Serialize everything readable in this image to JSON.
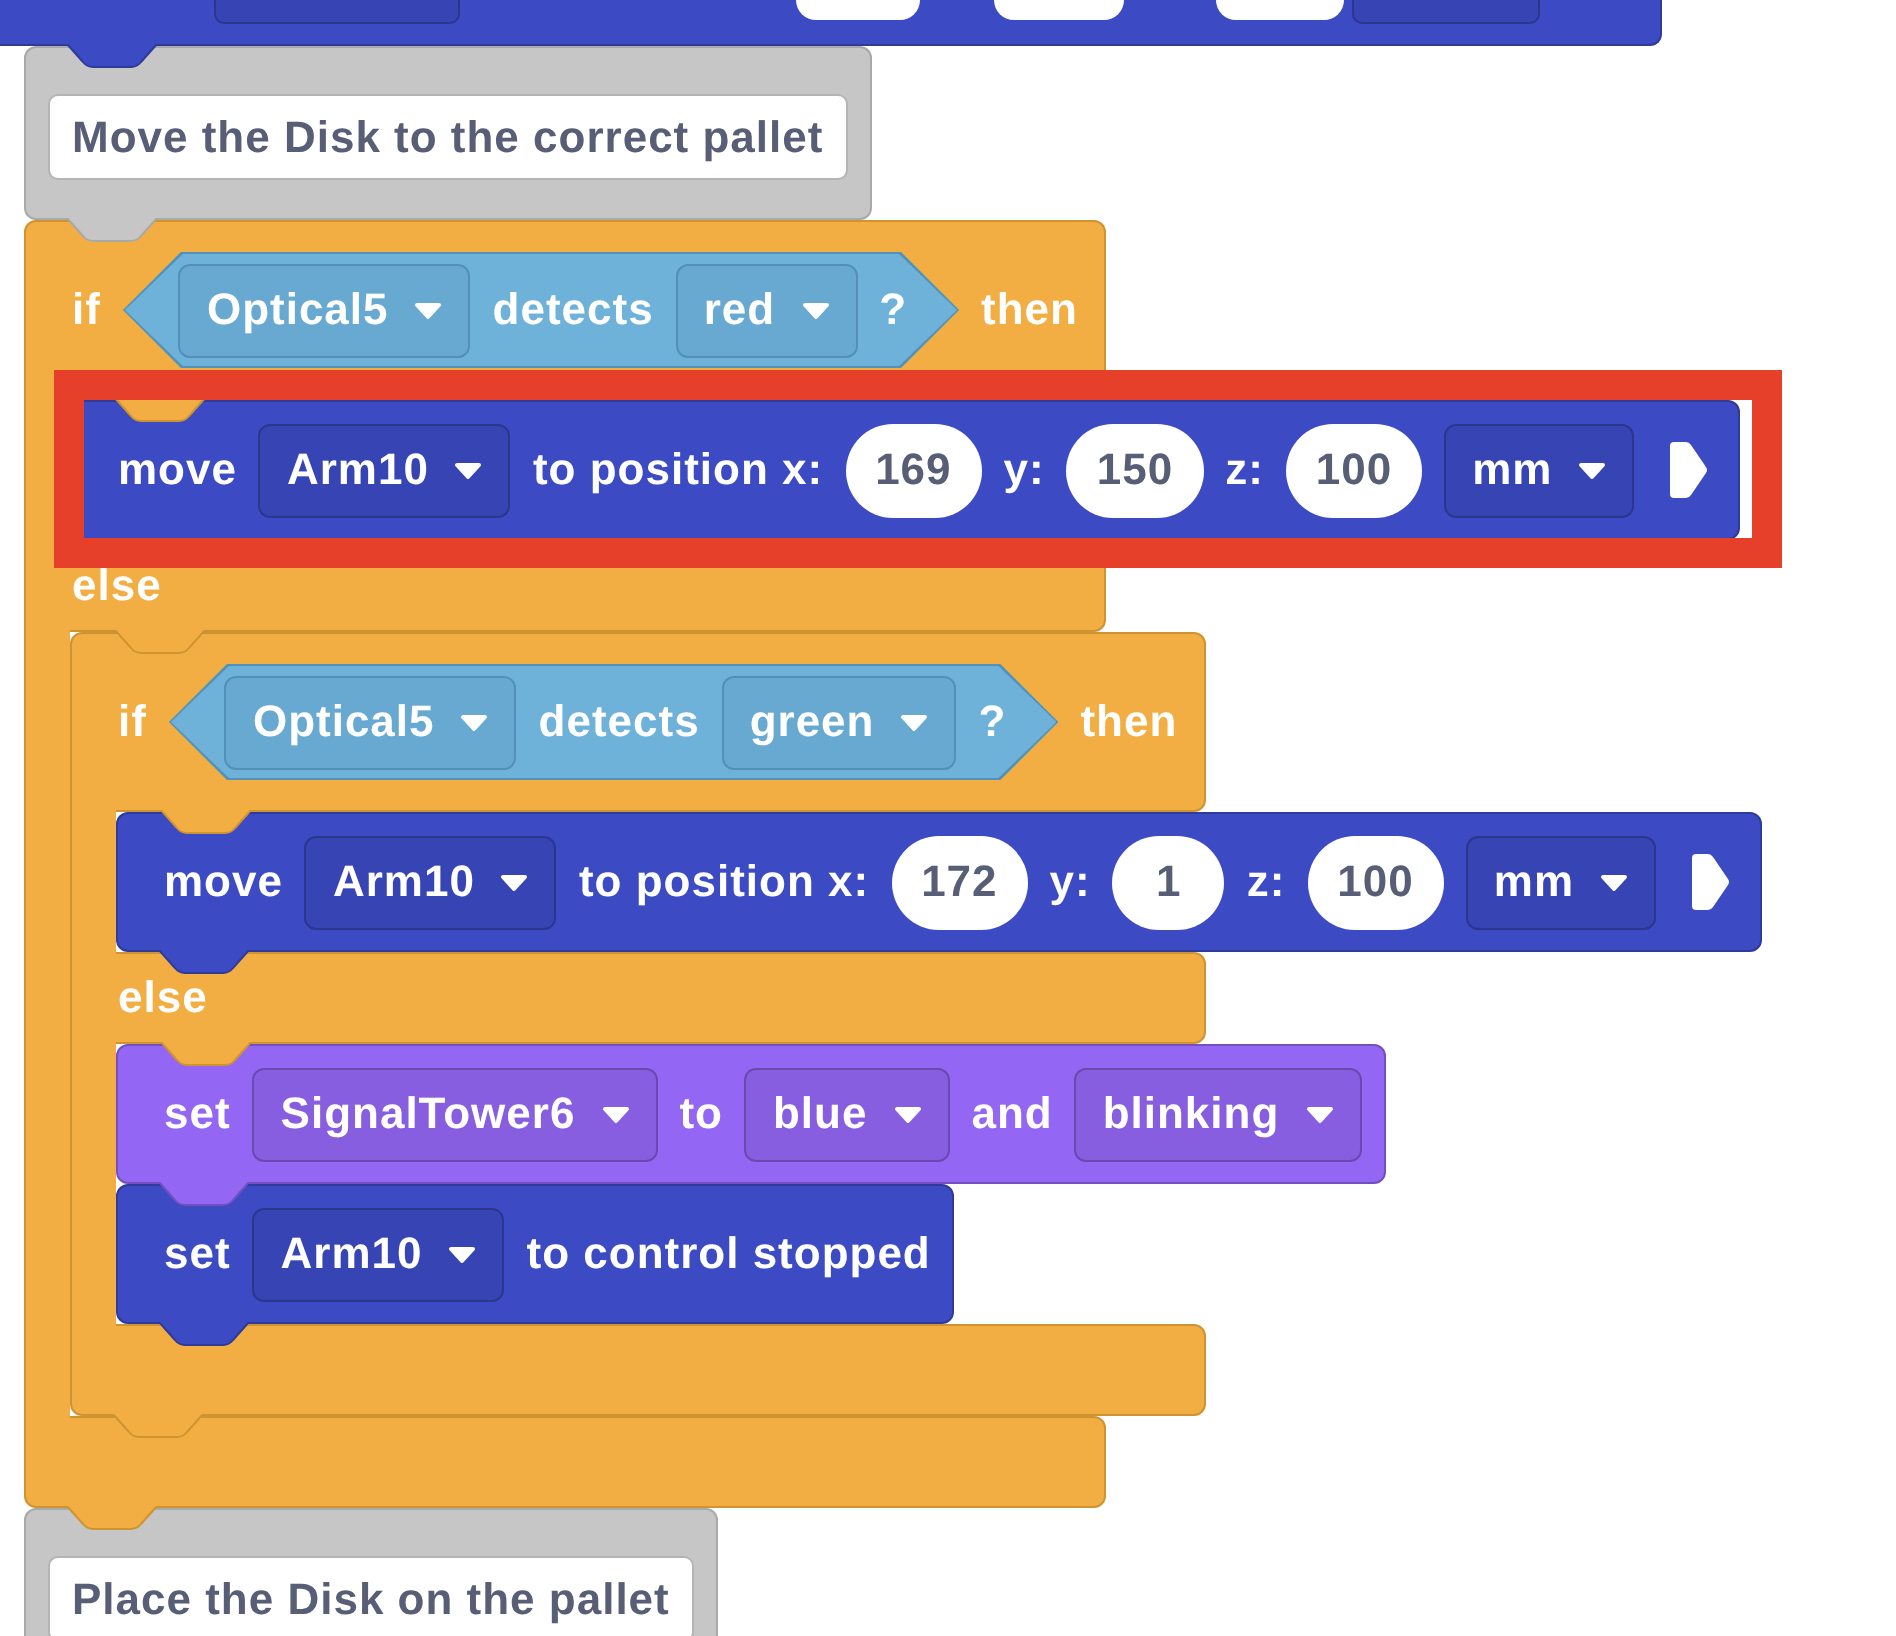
{
  "workspace": {
    "blocks": [
      {
        "kind": "partial",
        "color": "#3c4bc4",
        "highlighted": false,
        "parts": [
          {
            "kind": "dropdown"
          },
          {
            "kind": "number"
          },
          {
            "kind": "number"
          },
          {
            "kind": "number"
          },
          {
            "kind": "dropdown"
          }
        ]
      },
      {
        "kind": "comment",
        "highlighted": false,
        "text": "Move the Disk to the correct pallet"
      },
      {
        "kind": "if_else",
        "highlighted": false,
        "if_label": "if",
        "condition": {
          "kind": "boolean",
          "parts": [
            {
              "kind": "dropdown",
              "text": "Optical5"
            },
            {
              "kind": "label",
              "text": "detects"
            },
            {
              "kind": "dropdown",
              "text": "red"
            },
            {
              "kind": "label",
              "text": "?"
            }
          ]
        },
        "then_label": "then",
        "then": [
          {
            "kind": "stack",
            "color": "#3c4bc4",
            "highlighted": true,
            "parts": [
              {
                "kind": "label",
                "text": "move"
              },
              {
                "kind": "dropdown",
                "text": "Arm10"
              },
              {
                "kind": "label",
                "text": "to position x:"
              },
              {
                "kind": "number",
                "text": "169"
              },
              {
                "kind": "label",
                "text": "y:"
              },
              {
                "kind": "number",
                "text": "150"
              },
              {
                "kind": "label",
                "text": "z:"
              },
              {
                "kind": "number",
                "text": "100"
              },
              {
                "kind": "dropdown",
                "text": "mm"
              },
              {
                "kind": "arrow"
              }
            ]
          }
        ],
        "else_label": "else",
        "else": [
          {
            "kind": "if_else",
            "highlighted": false,
            "if_label": "if",
            "condition": {
              "kind": "boolean",
              "parts": [
                {
                  "kind": "dropdown",
                  "text": "Optical5"
                },
                {
                  "kind": "label",
                  "text": "detects"
                },
                {
                  "kind": "dropdown",
                  "text": "green"
                },
                {
                  "kind": "label",
                  "text": "?"
                }
              ]
            },
            "then_label": "then",
            "then": [
              {
                "kind": "stack",
                "color": "#3c4bc4",
                "highlighted": false,
                "parts": [
                  {
                    "kind": "label",
                    "text": "move"
                  },
                  {
                    "kind": "dropdown",
                    "text": "Arm10"
                  },
                  {
                    "kind": "label",
                    "text": "to position x:"
                  },
                  {
                    "kind": "number",
                    "text": "172"
                  },
                  {
                    "kind": "label",
                    "text": "y:"
                  },
                  {
                    "kind": "number",
                    "text": "1"
                  },
                  {
                    "kind": "label",
                    "text": "z:"
                  },
                  {
                    "kind": "number",
                    "text": "100"
                  },
                  {
                    "kind": "dropdown",
                    "text": "mm"
                  },
                  {
                    "kind": "arrow"
                  }
                ]
              }
            ],
            "else_label": "else",
            "else": [
              {
                "kind": "stack",
                "color": "#9466f4",
                "highlighted": false,
                "parts": [
                  {
                    "kind": "label",
                    "text": "set"
                  },
                  {
                    "kind": "dropdown",
                    "text": "SignalTower6"
                  },
                  {
                    "kind": "label",
                    "text": "to"
                  },
                  {
                    "kind": "dropdown",
                    "text": "blue"
                  },
                  {
                    "kind": "label",
                    "text": "and"
                  },
                  {
                    "kind": "dropdown",
                    "text": "blinking"
                  }
                ]
              },
              {
                "kind": "stack",
                "color": "#3c4bc4",
                "highlighted": false,
                "parts": [
                  {
                    "kind": "label",
                    "text": "set"
                  },
                  {
                    "kind": "dropdown",
                    "text": "Arm10"
                  },
                  {
                    "kind": "label",
                    "text": "to control stopped"
                  }
                ]
              }
            ]
          }
        ]
      },
      {
        "kind": "comment",
        "highlighted": false,
        "text": "Place the Disk on the pallet"
      }
    ]
  }
}
